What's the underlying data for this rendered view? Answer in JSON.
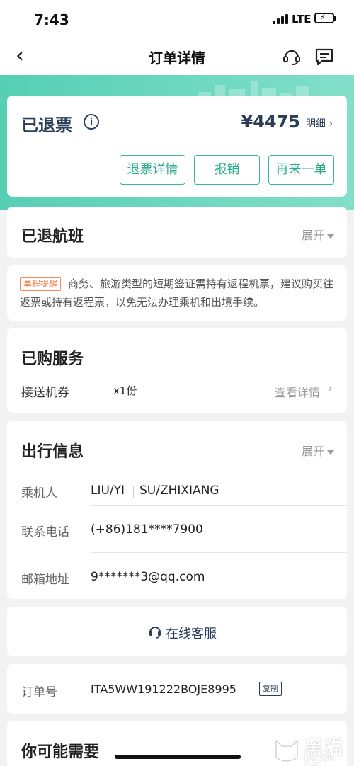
{
  "status_bar": {
    "time": "7:43",
    "network": "LTE",
    "bolt": "⚡"
  },
  "nav": {
    "back": "‹",
    "title": "订单详情",
    "support_icon": "headset-icon",
    "message_icon": "message-icon"
  },
  "status": {
    "title": "已退票",
    "info": "i",
    "price": "¥4475",
    "detail_link": "明细 ›",
    "buttons": [
      "退票详情",
      "报销",
      "再来一单"
    ]
  },
  "refunded_flight": {
    "title": "已退航班",
    "expand": "展开"
  },
  "notice": {
    "tag": "单程提醒",
    "text": "商务、旅游类型的短期签证需持有返程机票，建议购买往返票或持有返程票，以免无法办理乘机和出境手续。"
  },
  "services": {
    "title": "已购服务",
    "item_name": "接送机券",
    "item_qty": "x1份",
    "item_link": "查看详情",
    "chevron": "›"
  },
  "travel_info": {
    "title": "出行信息",
    "expand": "展开",
    "passenger_label": "乘机人",
    "passenger_1": "LIU/YI",
    "passenger_2": "SU/ZHIXIANG",
    "phone_label": "联系电话",
    "phone_value": "(+86)181****7900",
    "email_label": "邮箱地址",
    "email_value": "9*******3@qq.com"
  },
  "customer_service": {
    "label": "在线客服",
    "icon": "headset-icon"
  },
  "order": {
    "label": "订单号",
    "number": "ITA5WW191222BOJE8995",
    "copy": "复制"
  },
  "recommend": {
    "title": "你可能需要"
  },
  "watermark": {
    "text": "黑猫",
    "sub": "BLACK CAT"
  },
  "colors": {
    "accent": "#3ab79a",
    "banner": "#56cfb4",
    "navy": "#2c3e57",
    "notice_tag": "#f07a45"
  }
}
